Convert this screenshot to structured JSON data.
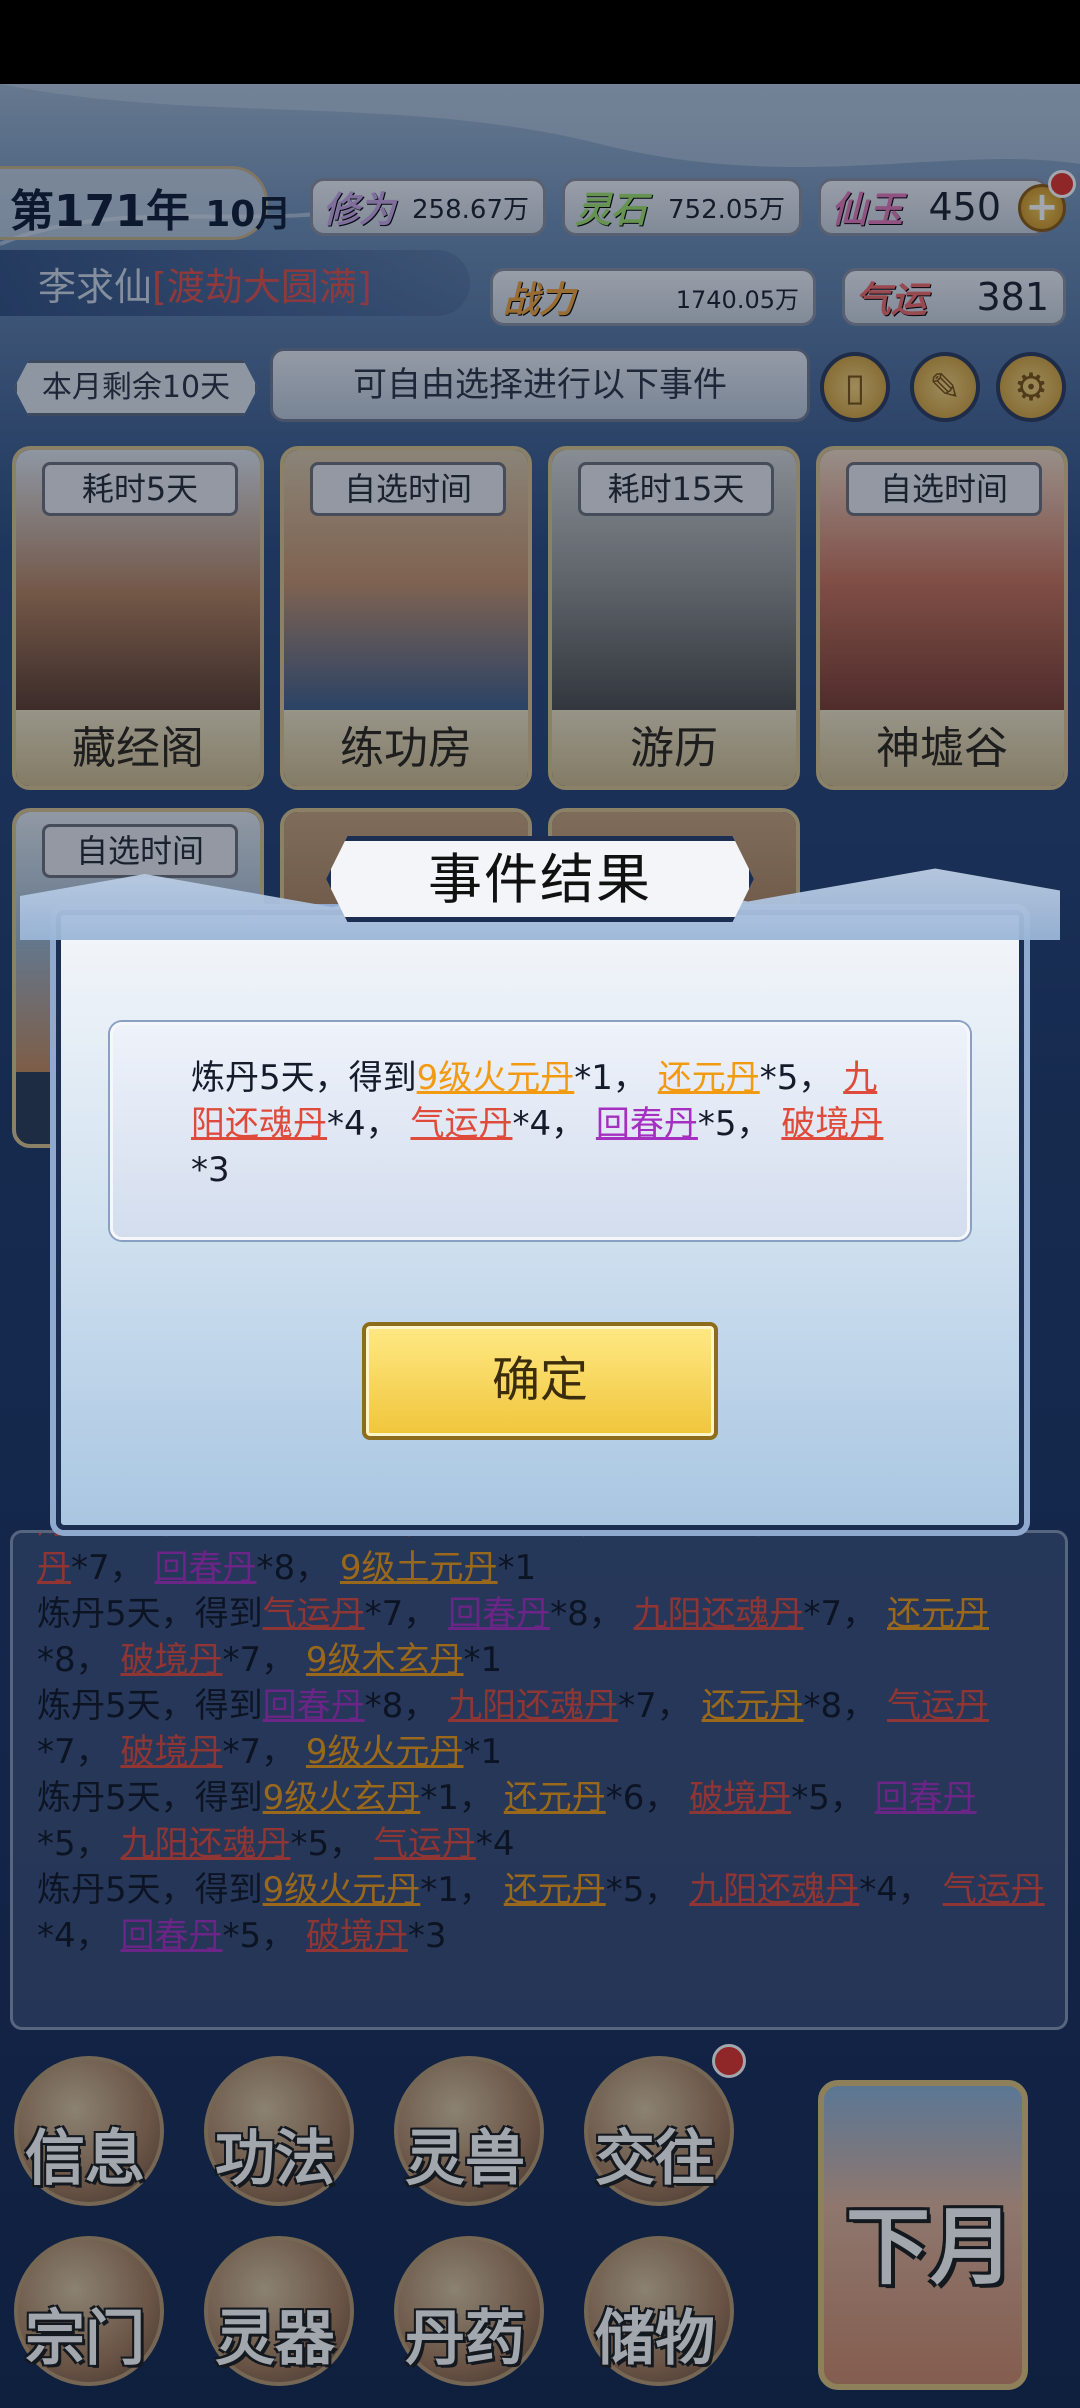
{
  "header": {
    "year": "第171年",
    "month": "10月",
    "cultivation": {
      "label": "修为",
      "value": "258.67万"
    },
    "spirit_stone": {
      "label": "灵石",
      "value": "752.05万"
    },
    "immortal_jade": {
      "label": "仙玉",
      "value": "450"
    },
    "player_name": "李求仙",
    "realm": "渡劫大圆满",
    "combat_power": {
      "label": "战力",
      "value": "1740.05万"
    },
    "luck": {
      "label": "气运",
      "value": "381"
    }
  },
  "banner": {
    "days_left": "本月剩余10天",
    "hint": "可自由选择进行以下事件"
  },
  "locations": [
    {
      "tag": "耗时5天",
      "name": "藏经阁"
    },
    {
      "tag": "自选时间",
      "name": "练功房"
    },
    {
      "tag": "耗时15天",
      "name": "游历"
    },
    {
      "tag": "自选时间",
      "name": "神墟谷"
    },
    {
      "tag": "自选时间",
      "name": ""
    }
  ],
  "modal": {
    "title": "事件结果",
    "result_prefix": "炼丹5天，得到",
    "items": [
      {
        "name": "9级火元丹",
        "count": "*1",
        "color": "orange"
      },
      {
        "name": "还元丹",
        "count": "*5",
        "color": "orange"
      },
      {
        "name": "九阳还魂丹",
        "count": "*4",
        "color": "red"
      },
      {
        "name": "气运丹",
        "count": "*4",
        "color": "red"
      },
      {
        "name": "回春丹",
        "count": "*5",
        "color": "purple"
      },
      {
        "name": "破境丹",
        "count": "*3",
        "color": "red"
      }
    ],
    "confirm": "确定"
  },
  "log": [
    {
      "prefix": "",
      "items": [
        {
          "name": "丹",
          "count": "*7",
          "color": "red"
        },
        {
          "name": "回春丹",
          "count": "*8",
          "color": "purple"
        },
        {
          "name": "9级土元丹",
          "count": "*1",
          "color": "orange"
        }
      ]
    },
    {
      "prefix": "炼丹5天，得到",
      "items": [
        {
          "name": "气运丹",
          "count": "*7",
          "color": "red"
        },
        {
          "name": "回春丹",
          "count": "*8",
          "color": "purple"
        },
        {
          "name": "九阳还魂丹",
          "count": "*7",
          "color": "red"
        },
        {
          "name": "还元丹",
          "count": "*8",
          "color": "orange"
        },
        {
          "name": "破境丹",
          "count": "*7",
          "color": "red"
        },
        {
          "name": "9级木玄丹",
          "count": "*1",
          "color": "orange"
        }
      ]
    },
    {
      "prefix": "炼丹5天，得到",
      "items": [
        {
          "name": "回春丹",
          "count": "*8",
          "color": "purple"
        },
        {
          "name": "九阳还魂丹",
          "count": "*7",
          "color": "red"
        },
        {
          "name": "还元丹",
          "count": "*8",
          "color": "orange"
        },
        {
          "name": "气运丹",
          "count": "*7",
          "color": "red"
        },
        {
          "name": "破境丹",
          "count": "*7",
          "color": "red"
        },
        {
          "name": "9级火元丹",
          "count": "*1",
          "color": "orange"
        }
      ]
    },
    {
      "prefix": "炼丹5天，得到",
      "items": [
        {
          "name": "9级火玄丹",
          "count": "*1",
          "color": "orange"
        },
        {
          "name": "还元丹",
          "count": "*6",
          "color": "orange"
        },
        {
          "name": "破境丹",
          "count": "*5",
          "color": "red"
        },
        {
          "name": "回春丹",
          "count": "*5",
          "color": "purple"
        },
        {
          "name": "九阳还魂丹",
          "count": "*5",
          "color": "red"
        },
        {
          "name": "气运丹",
          "count": "*4",
          "color": "red"
        }
      ]
    },
    {
      "prefix": "炼丹5天，得到",
      "items": [
        {
          "name": "9级火元丹",
          "count": "*1",
          "color": "orange"
        },
        {
          "name": "还元丹",
          "count": "*5",
          "color": "orange"
        },
        {
          "name": "九阳还魂丹",
          "count": "*4",
          "color": "red"
        },
        {
          "name": "气运丹",
          "count": "*4",
          "color": "red"
        },
        {
          "name": "回春丹",
          "count": "*5",
          "color": "purple"
        },
        {
          "name": "破境丹",
          "count": "*3",
          "color": "red"
        }
      ]
    }
  ],
  "menu": {
    "buttons": [
      "信息",
      "功法",
      "灵兽",
      "交往",
      "宗门",
      "灵器",
      "丹药",
      "储物"
    ],
    "next_month": "下月"
  },
  "colors": {
    "orange": "#f29b12",
    "red": "#e04a3a",
    "purple": "#a52fc0",
    "gold": "#f0c53a"
  }
}
